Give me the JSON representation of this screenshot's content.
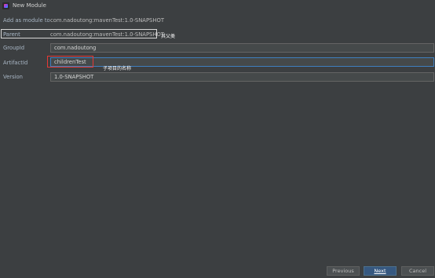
{
  "window": {
    "title": "New Module"
  },
  "form": {
    "add_as_module": {
      "label": "Add as module to",
      "value": "com.nadoutong:mavenTest:1.0-SNAPSHOT"
    },
    "parent": {
      "label": "Parent",
      "value": "com.nadoutong:mavenTest:1.0-SNAPSHOT",
      "annotation": "其父类"
    },
    "groupid": {
      "label": "GroupId",
      "value": "com.nadoutong"
    },
    "artifactid": {
      "label": "ArtifactId",
      "value": "childrenTest",
      "annotation": "子项目的名称"
    },
    "version": {
      "label": "Version",
      "value": "1.0-SNAPSHOT"
    }
  },
  "buttons": {
    "previous": "Previous",
    "next": "Next",
    "cancel": "Cancel"
  },
  "colors": {
    "background": "#3c3f41",
    "input_bg": "#45494a",
    "highlight_red": "#e53935",
    "primary_button": "#365880"
  }
}
